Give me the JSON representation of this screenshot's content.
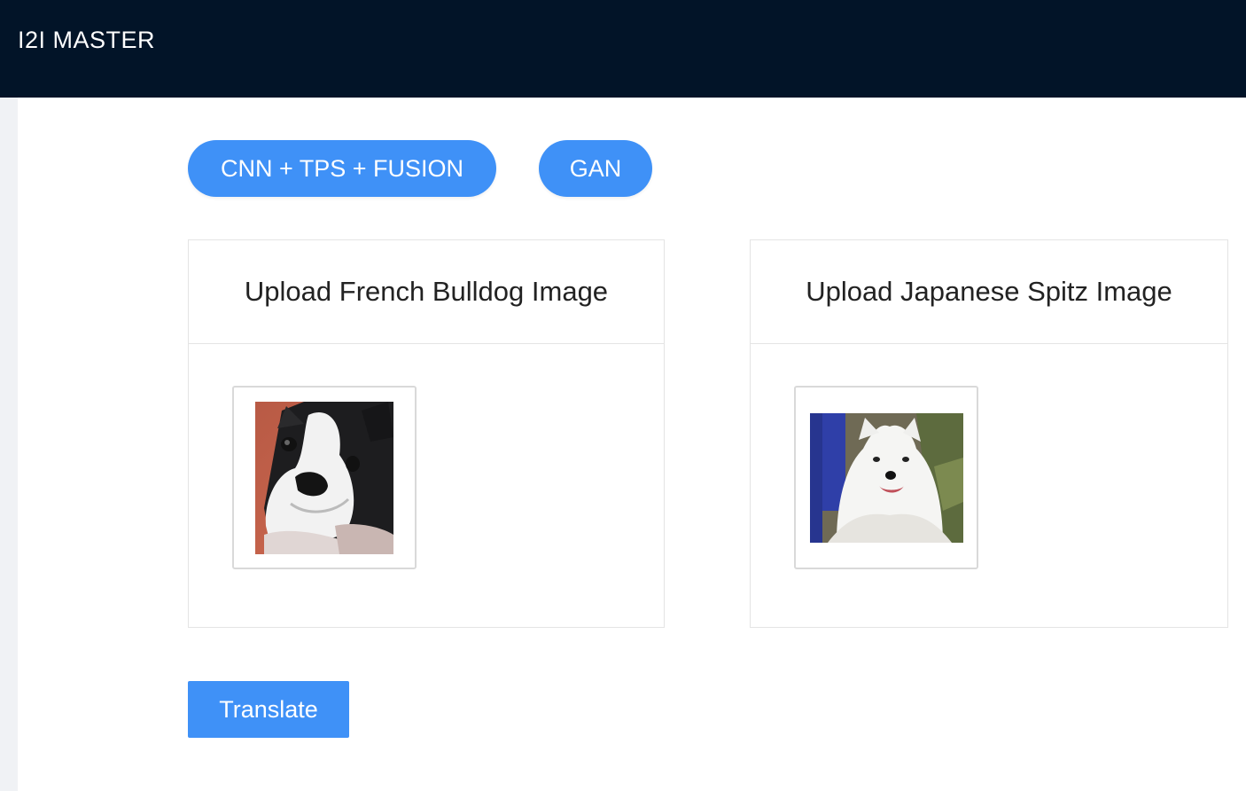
{
  "header": {
    "title": "I2I MASTER"
  },
  "modes": [
    {
      "label": "CNN + TPS + FUSION"
    },
    {
      "label": "GAN"
    }
  ],
  "uploads": [
    {
      "title": "Upload French Bulldog Image",
      "image": "french-bulldog-photo"
    },
    {
      "title": "Upload Japanese Spitz Image",
      "image": "japanese-spitz-photo"
    }
  ],
  "actions": {
    "translate_label": "Translate"
  },
  "colors": {
    "header_bg": "#021428",
    "accent": "#3f91f7",
    "rail": "#f0f2f5"
  }
}
